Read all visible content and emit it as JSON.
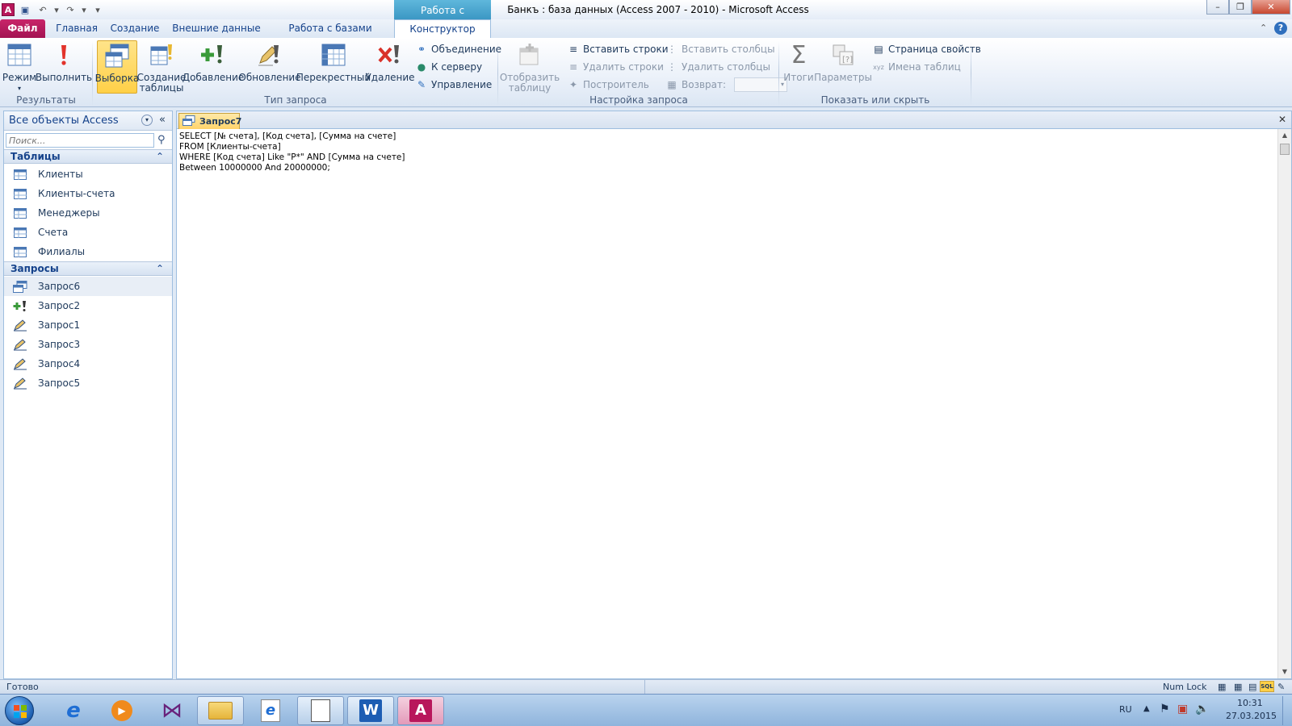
{
  "window": {
    "title": "Банкъ : база данных (Access 2007 - 2010)  -  Microsoft Access",
    "context_group": "Работа с запросами"
  },
  "tabs": [
    "Файл",
    "Главная",
    "Создание",
    "Внешние данные",
    "Работа с базами данных",
    "Конструктор"
  ],
  "ribbon": {
    "results": {
      "label": "Результаты",
      "mode": "Режим",
      "run": "Выполнить"
    },
    "query_type": {
      "label": "Тип запроса",
      "select": "Выборка",
      "make_table_1": "Создание",
      "make_table_2": "таблицы",
      "append": "Добавление",
      "update": "Обновление",
      "crosstab": "Перекрестный",
      "delete": "Удаление",
      "union": "Объединение",
      "pass_through": "К серверу",
      "data_def": "Управление"
    },
    "setup": {
      "label": "Настройка запроса",
      "show_table_1": "Отобразить",
      "show_table_2": "таблицу",
      "insert_rows": "Вставить строки",
      "delete_rows": "Удалить строки",
      "builder": "Построитель",
      "insert_cols": "Вставить столбцы",
      "delete_cols": "Удалить столбцы",
      "return": "Возврат:"
    },
    "show_hide": {
      "label": "Показать или скрыть",
      "totals": "Итоги",
      "params": "Параметры",
      "prop_sheet": "Страница свойств",
      "table_names": "Имена таблиц"
    }
  },
  "nav": {
    "title": "Все объекты Access",
    "search_placeholder": "Поиск...",
    "tables_header": "Таблицы",
    "tables": [
      "Клиенты",
      "Клиенты-счета",
      "Менеджеры",
      "Счета",
      "Филиалы"
    ],
    "queries_header": "Запросы",
    "queries": [
      "Запрос6",
      "Запрос2",
      "Запрос1",
      "Запрос3",
      "Запрос4",
      "Запрос5"
    ]
  },
  "document": {
    "tab": "Запрос7",
    "sql_lines": [
      "SELECT [№ счета], [Код счета], [Сумма на счете]",
      "FROM [Клиенты-счета]",
      "WHERE [Код счета] Like \"Р*\" AND [Сумма на счете]",
      "Between 10000000 And 20000000;"
    ]
  },
  "status": {
    "left": "Готово",
    "numlock": "Num Lock",
    "sql": "SQL"
  },
  "taskbar": {
    "lang": "RU",
    "time": "10:31",
    "date": "27.03.2015"
  },
  "colors": {
    "file_tab": "#b8175b",
    "context": "#4aa6d2",
    "selected": "#ffd047"
  }
}
